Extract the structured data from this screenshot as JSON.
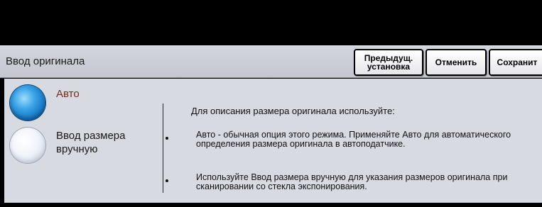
{
  "header": {
    "title": "Ввод оригинала",
    "buttons": {
      "previous_line1": "Предыдущ.",
      "previous_line2": "установка",
      "cancel": "Отменить",
      "save": "Сохранит"
    }
  },
  "options": {
    "auto": {
      "label": "Авто",
      "selected": true,
      "color": "#7b2a1c"
    },
    "manual": {
      "label": "Ввод размера вручную",
      "selected": false
    }
  },
  "info": {
    "heading": "Для описания размера оригинала используйте:",
    "bullets": [
      "Авто - обычная опция этого режима.  Применяйте Авто для автоматического определения размера оригинала в автоподатчике.",
      "Используйте Ввод размера вручную для указания размеров оригинала при сканировании со стекла экспонирования."
    ]
  },
  "colors": {
    "radio_selected": "#1374c2",
    "header_bg": "#c8cad4",
    "content_bg": "#d8dae1"
  }
}
